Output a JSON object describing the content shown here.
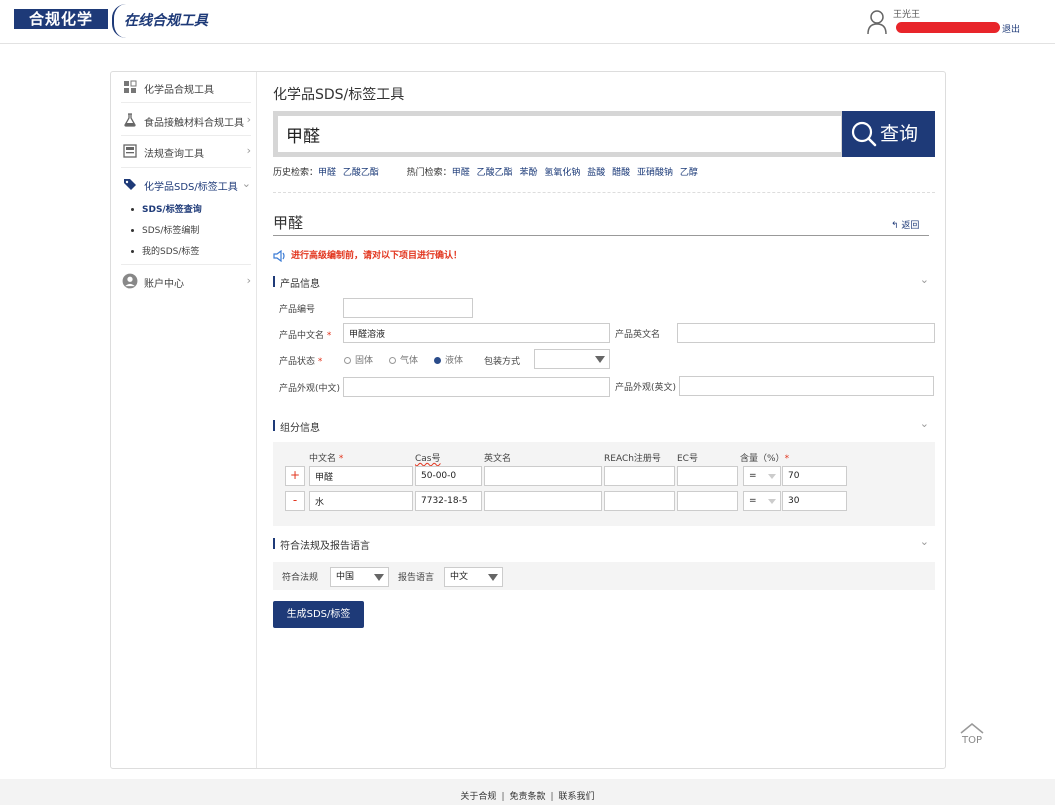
{
  "header": {
    "logo_text": "合规化学",
    "logo_sub": "在线合规工具",
    "user_name": "王光王",
    "logout_label": "退出"
  },
  "sidebar": {
    "items": [
      {
        "label": "化学品合规工具"
      },
      {
        "label": "食品接触材料合规工具"
      },
      {
        "label": "法规查询工具"
      },
      {
        "label": "化学品SDS/标签工具"
      },
      {
        "label": "账户中心"
      }
    ],
    "subitems": [
      {
        "label": "SDS/标签查询"
      },
      {
        "label": "SDS/标签编制"
      },
      {
        "label": "我的SDS/标签"
      }
    ]
  },
  "main": {
    "page_title": "化学品SDS/标签工具",
    "search_value": "甲醛",
    "search_button": "查询",
    "history_label": "历史检索：",
    "history_items": [
      "甲醛",
      "乙酸乙酯"
    ],
    "hot_label": "热门检索：",
    "hot_items": [
      "甲醛",
      "乙酸乙酯",
      "苯酚",
      "氢氧化钠",
      "盐酸",
      "醋酸",
      "亚硝酸钠",
      "乙醇"
    ],
    "sub_title": "甲醛",
    "back_label": "返回",
    "notice": "进行高级编制前，请对以下项目进行确认！"
  },
  "product": {
    "section_title": "产品信息",
    "code_label": "产品编号",
    "code_value": "",
    "cn_name_label": "产品中文名",
    "cn_name_value": "甲醛溶液",
    "en_name_label": "产品英文名",
    "en_name_value": "",
    "state_label": "产品状态",
    "states": [
      "固体",
      "气体",
      "液体"
    ],
    "pack_label": "包装方式",
    "pack_value": "",
    "appearance_cn_label": "产品外观(中文)",
    "appearance_cn_value": "",
    "appearance_en_label": "产品外观(英文)",
    "appearance_en_value": ""
  },
  "components": {
    "section_title": "组分信息",
    "headers": [
      "中文名",
      "Cas号",
      "英文名",
      "REACh注册号",
      "EC号",
      "含量（%）"
    ],
    "rows": [
      {
        "btn": "+",
        "cn": "甲醛",
        "cas": "50-00-0",
        "en": "",
        "reach": "",
        "ec": "",
        "op": "=",
        "amount": "70"
      },
      {
        "btn": "-",
        "cn": "水",
        "cas": "7732-18-5",
        "en": "",
        "reach": "",
        "ec": "",
        "op": "=",
        "amount": "30"
      }
    ]
  },
  "law": {
    "section_title": "符合法规及报告语言",
    "law_label": "符合法规",
    "law_value": "中国",
    "lang_label": "报告语言",
    "lang_value": "中文"
  },
  "generate_button": "生成SDS/标签",
  "top_label": "TOP",
  "footer": {
    "links": [
      "关于合规",
      "免责条款",
      "联系我们"
    ]
  },
  "colors": {
    "brand": "#1e3a78",
    "required": "#e2351e",
    "redaction": "#e8252a"
  }
}
